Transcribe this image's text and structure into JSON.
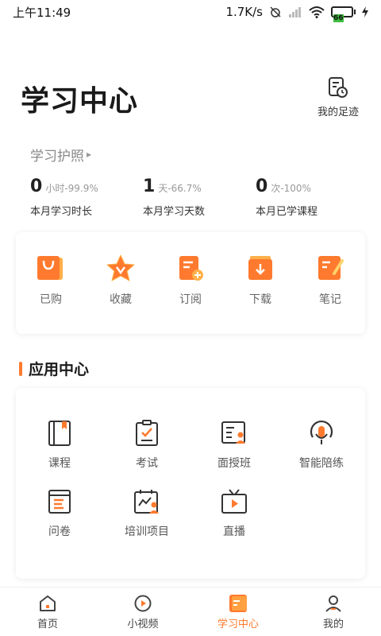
{
  "status_bar": {
    "time": "上午11:49",
    "network_speed": "1.7K/s",
    "battery_level": "66"
  },
  "header": {
    "title": "学习中心",
    "footprint_label": "我的足迹"
  },
  "passport": {
    "title": "学习护照",
    "stats": [
      {
        "value": "0",
        "unit": "小时-99.9%",
        "label": "本月学习时长"
      },
      {
        "value": "1",
        "unit": "天-66.7%",
        "label": "本月学习天数"
      },
      {
        "value": "0",
        "unit": "次-100%",
        "label": "本月已学课程"
      }
    ]
  },
  "quick_actions": [
    {
      "label": "已购",
      "icon": "shopping-bag-icon"
    },
    {
      "label": "收藏",
      "icon": "star-icon"
    },
    {
      "label": "订阅",
      "icon": "subscribe-icon"
    },
    {
      "label": "下载",
      "icon": "download-icon"
    },
    {
      "label": "笔记",
      "icon": "note-icon"
    }
  ],
  "app_center": {
    "title": "应用中心",
    "items": [
      {
        "label": "课程",
        "icon": "book-icon"
      },
      {
        "label": "考试",
        "icon": "exam-icon"
      },
      {
        "label": "面授班",
        "icon": "classroom-icon"
      },
      {
        "label": "智能陪练",
        "icon": "mic-icon"
      },
      {
        "label": "问卷",
        "icon": "survey-icon"
      },
      {
        "label": "培训项目",
        "icon": "training-icon"
      },
      {
        "label": "直播",
        "icon": "live-icon"
      }
    ]
  },
  "bottom_nav": [
    {
      "label": "首页",
      "icon": "home-icon",
      "active": false
    },
    {
      "label": "小视频",
      "icon": "video-icon",
      "active": false
    },
    {
      "label": "学习中心",
      "icon": "study-center-icon",
      "active": true
    },
    {
      "label": "我的",
      "icon": "profile-icon",
      "active": false
    }
  ],
  "colors": {
    "accent": "#ff7a2e",
    "accent_light": "#ffb04a"
  }
}
